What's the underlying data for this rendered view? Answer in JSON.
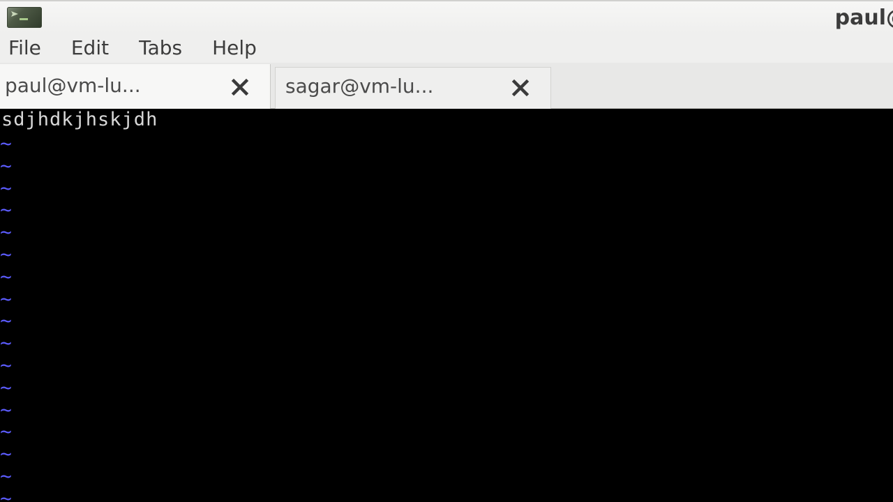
{
  "window": {
    "title": "paul@"
  },
  "menu": {
    "items": [
      "File",
      "Edit",
      "Tabs",
      "Help"
    ]
  },
  "tabs": [
    {
      "label": "paul@vm-lu...",
      "active": true
    },
    {
      "label": "sagar@vm-lu...",
      "active": false
    }
  ],
  "terminal": {
    "lines": [
      "sdjhdkjhskjdh"
    ],
    "empty_line_marker": "~",
    "marker_color": "#5c5cff",
    "text_color": "#d8d8d8"
  }
}
